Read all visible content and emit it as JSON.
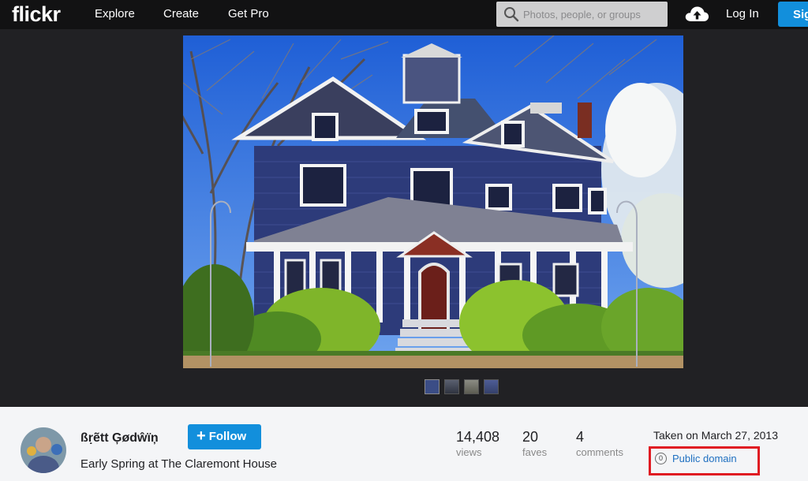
{
  "header": {
    "logo": "flickr",
    "nav": [
      {
        "label": "Explore"
      },
      {
        "label": "Create"
      },
      {
        "label": "Get Pro"
      }
    ],
    "search": {
      "placeholder": "Photos, people, or groups",
      "value": ""
    },
    "upload_icon": "cloud-upload-icon",
    "login_label": "Log In",
    "signup_label": "Sig"
  },
  "photo": {
    "subject": "Victorian house with blue siding, white trim and front porch under blue sky",
    "thumbnails": [
      {
        "icon": "thumbnail-house-1"
      },
      {
        "icon": "thumbnail-house-2"
      },
      {
        "icon": "thumbnail-house-3"
      },
      {
        "icon": "thumbnail-house-4"
      }
    ]
  },
  "info": {
    "owner": "ßṛẽtt Ģødŵïņ",
    "follow_label": "Follow",
    "title": "Early Spring at The Claremont House",
    "stats": [
      {
        "value": "14,408",
        "label": "views"
      },
      {
        "value": "20",
        "label": "faves"
      },
      {
        "value": "4",
        "label": "comments"
      }
    ],
    "taken": "Taken on March 27, 2013",
    "license": {
      "icon_text": "0",
      "label": "Public domain"
    }
  },
  "colors": {
    "brand_blue": "#128fdc",
    "header_bg": "#121213",
    "stage_bg": "#212124",
    "highlight_red": "#e01b22",
    "link_blue": "#1e6fc0"
  }
}
